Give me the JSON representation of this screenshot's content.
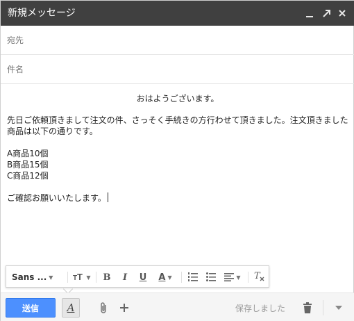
{
  "window": {
    "title": "新規メッセージ",
    "controls": [
      "minimize-icon",
      "expand-icon",
      "close-icon"
    ]
  },
  "fields": {
    "to_placeholder": "宛先",
    "subject_placeholder": "件名"
  },
  "message": {
    "greeting": "おはようございます。",
    "paragraph": "先日ご依頼頂きまして注文の件、さっそく手続きの方行わせて頂きました。注文頂きました商品は以下の通りです。",
    "items": [
      "A商品10個",
      "B商品15個",
      "C商品12個"
    ],
    "closing": "ご確認お願いいたします。"
  },
  "format_toolbar": {
    "font_label": "Sans ...",
    "size_icon": "text-size-icon",
    "bold_label": "B",
    "italic_label": "I",
    "underline_label": "U",
    "text_color_label": "A",
    "numbered_list_icon": "numbered-list-icon",
    "bulleted_list_icon": "bulleted-list-icon",
    "align_icon": "align-icon",
    "clear_format_icon": "remove-formatting-icon"
  },
  "bottom_bar": {
    "send_label": "送信",
    "format_toggle_label": "A",
    "status_text": "保存しました",
    "icons": [
      "paperclip-icon",
      "plus-icon",
      "trash-icon",
      "chevron-down-icon"
    ]
  },
  "colors": {
    "title_bar": "#404040",
    "send_button": "#4d90fe"
  }
}
